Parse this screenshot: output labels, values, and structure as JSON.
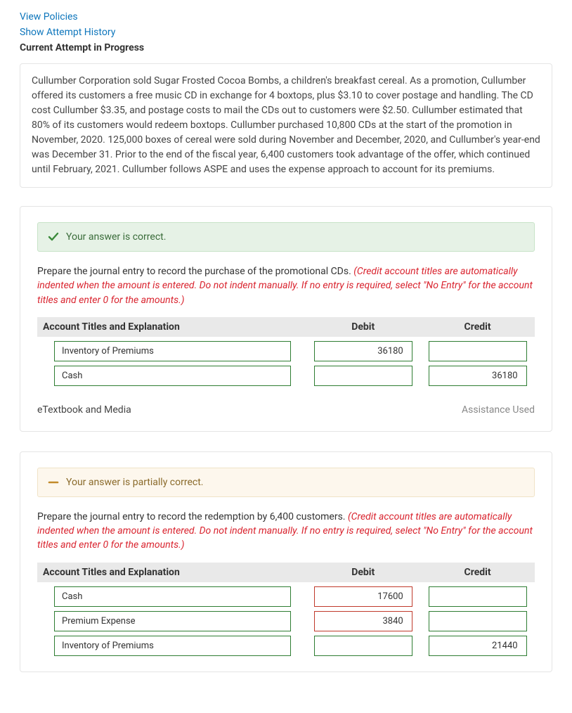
{
  "links": {
    "view_policies": "View Policies",
    "show_attempt_history": "Show Attempt History"
  },
  "heading": "Current Attempt in Progress",
  "problem_text": "Cullumber Corporation sold Sugar Frosted Cocoa Bombs, a children's breakfast cereal. As a promotion, Cullumber offered its customers a free music CD in exchange for 4 boxtops, plus $3.10 to cover postage and handling. The CD cost Cullumber $3.35, and postage costs to mail the CDs out to customers were $2.50. Cullumber estimated that 80% of its customers would redeem boxtops. Cullumber purchased 10,800 CDs at the start of the promotion in November, 2020. 125,000 boxes of cereal were sold during November and December, 2020, and Cullumber's year-end was December 31. Prior to the end of the fiscal year, 6,400 customers took advantage of the offer, which continued until February, 2021. Cullumber follows ASPE and uses the expense approach to account for its premiums.",
  "sections": [
    {
      "status": "correct",
      "banner_text": "Your answer is correct.",
      "prompt_plain": "Prepare the journal entry to record the purchase of the promotional CDs. ",
      "prompt_note": "(Credit account titles are automatically indented when the amount is entered. Do not indent manually. If no entry is required, select \"No Entry\" for the account titles and enter 0 for the amounts.)",
      "headers": {
        "acct": "Account Titles and Explanation",
        "debit": "Debit",
        "credit": "Credit"
      },
      "rows": [
        {
          "acct": "Inventory of Premiums",
          "debit": "36180",
          "credit": "",
          "debit_err": false,
          "credit_err": false
        },
        {
          "acct": "Cash",
          "debit": "",
          "credit": "36180",
          "debit_err": false,
          "credit_err": false
        }
      ],
      "footer": {
        "etext": "eTextbook and Media",
        "assist": "Assistance Used"
      }
    },
    {
      "status": "partial",
      "banner_text": "Your answer is partially correct.",
      "prompt_plain": "Prepare the journal entry to record the redemption by 6,400 customers. ",
      "prompt_note": "(Credit account titles are automatically indented when the amount is entered. Do not indent manually. If no entry is required, select \"No Entry\" for the account titles and enter 0 for the amounts.)",
      "headers": {
        "acct": "Account Titles and Explanation",
        "debit": "Debit",
        "credit": "Credit"
      },
      "rows": [
        {
          "acct": "Cash",
          "debit": "17600",
          "credit": "",
          "debit_err": true,
          "credit_err": false
        },
        {
          "acct": "Premium Expense",
          "debit": "3840",
          "credit": "",
          "debit_err": true,
          "credit_err": false
        },
        {
          "acct": "Inventory of Premiums",
          "debit": "",
          "credit": "21440",
          "debit_err": false,
          "credit_err": false
        }
      ],
      "footer": null
    }
  ]
}
